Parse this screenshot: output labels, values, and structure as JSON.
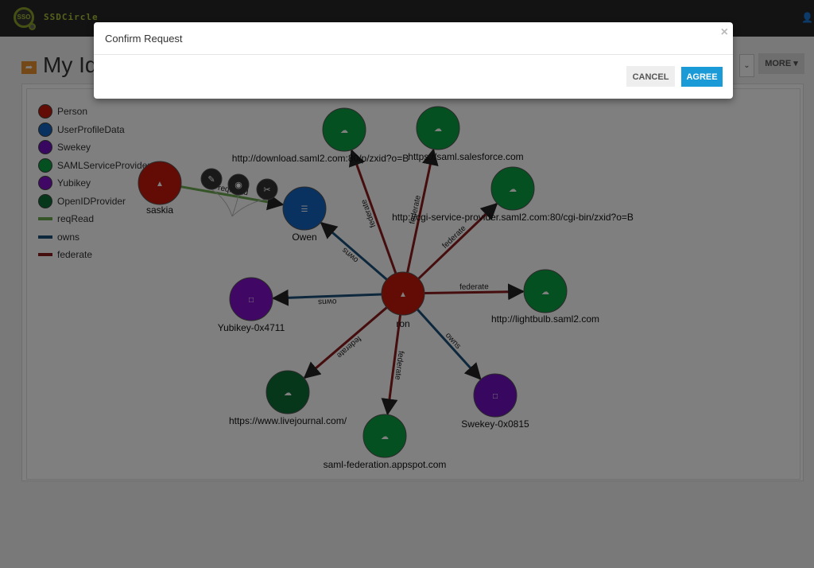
{
  "header": {
    "brand": "SSDCircle",
    "logo_text": "SSO",
    "user_icon": "user-icon"
  },
  "page": {
    "title": "My Identity Graph",
    "title_visible": "My Id",
    "more_label": "MORE ▾",
    "select_caret": "⌄"
  },
  "modal": {
    "title": "Confirm Request",
    "close_label": "×",
    "cancel_label": "CANCEL",
    "agree_label": "AGREE"
  },
  "legend": [
    {
      "label": "Person",
      "kind": "node",
      "color": "#c4190a"
    },
    {
      "label": "UserProfileData",
      "kind": "node",
      "color": "#1565c0"
    },
    {
      "label": "Swekey",
      "kind": "node",
      "color": "#7010c0"
    },
    {
      "label": "SAMLServiceProvider",
      "kind": "node",
      "color": "#0aa040"
    },
    {
      "label": "Yubikey",
      "kind": "node",
      "color": "#8010c8"
    },
    {
      "label": "OpenIDProvider",
      "kind": "node",
      "color": "#0c6e36"
    },
    {
      "label": "reqRead",
      "kind": "edge",
      "color": "#6aa84f"
    },
    {
      "label": "owns",
      "kind": "edge",
      "color": "#1a4f7a"
    },
    {
      "label": "federate",
      "kind": "edge",
      "color": "#8b1a1a"
    }
  ],
  "graph": {
    "nodes": [
      {
        "id": "ron",
        "label": "ron",
        "type": "Person",
        "icon": "person-icon"
      },
      {
        "id": "saskia",
        "label": "saskia",
        "type": "Person",
        "icon": "person-icon"
      },
      {
        "id": "owen",
        "label": "Owen",
        "type": "UserProfileData",
        "icon": "list-icon"
      },
      {
        "id": "download",
        "label": "http://download.saml2.com:80/p/zxid?o=B",
        "type": "SAMLServiceProvider",
        "icon": "cloud-icon"
      },
      {
        "id": "salesforce",
        "label": "https://saml.salesforce.com",
        "type": "SAMLServiceProvider",
        "icon": "cloud-icon"
      },
      {
        "id": "cgi",
        "label": "http://cgi-service-provider.saml2.com:80/cgi-bin/zxid?o=B",
        "type": "SAMLServiceProvider",
        "icon": "cloud-icon"
      },
      {
        "id": "lightbulb",
        "label": "http://lightbulb.saml2.com",
        "type": "SAMLServiceProvider",
        "icon": "cloud-icon"
      },
      {
        "id": "yubikey",
        "label": "Yubikey-0x4711",
        "type": "Yubikey",
        "icon": "square-icon"
      },
      {
        "id": "swekey",
        "label": "Swekey-0x0815",
        "type": "Swekey",
        "icon": "square-icon"
      },
      {
        "id": "livejournal",
        "label": "https://www.livejournal.com/",
        "type": "OpenIDProvider",
        "icon": "cloud-icon"
      },
      {
        "id": "appspot",
        "label": "saml-federation.appspot.com",
        "type": "SAMLServiceProvider",
        "icon": "cloud-icon"
      }
    ],
    "edges": [
      {
        "from": "saskia",
        "to": "owen",
        "label": "reqRead",
        "type": "reqRead"
      },
      {
        "from": "ron",
        "to": "owen",
        "label": "owns",
        "type": "owns"
      },
      {
        "from": "ron",
        "to": "yubikey",
        "label": "owns",
        "type": "owns"
      },
      {
        "from": "ron",
        "to": "swekey",
        "label": "owns",
        "type": "owns"
      },
      {
        "from": "ron",
        "to": "download",
        "label": "federate",
        "type": "federate"
      },
      {
        "from": "ron",
        "to": "salesforce",
        "label": "federate",
        "type": "federate"
      },
      {
        "from": "ron",
        "to": "cgi",
        "label": "federate",
        "type": "federate"
      },
      {
        "from": "ron",
        "to": "lightbulb",
        "label": "federate",
        "type": "federate"
      },
      {
        "from": "ron",
        "to": "livejournal",
        "label": "federate",
        "type": "federate"
      },
      {
        "from": "ron",
        "to": "appspot",
        "label": "federate",
        "type": "federate"
      }
    ],
    "edge_actions": [
      {
        "name": "edit-icon",
        "glyph": "✎"
      },
      {
        "name": "eye-icon",
        "glyph": "◉"
      },
      {
        "name": "unlink-icon",
        "glyph": "✂"
      }
    ]
  }
}
